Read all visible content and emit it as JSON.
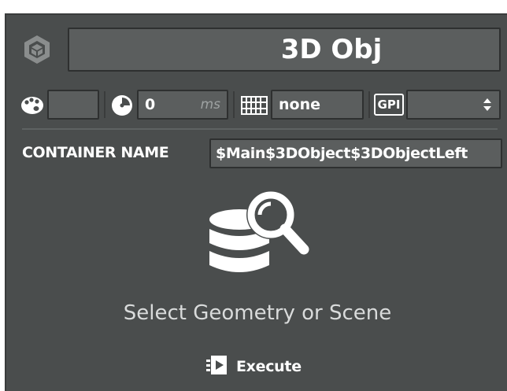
{
  "header": {
    "title": "3D Obj",
    "app_icon": "hexagon-box-icon"
  },
  "toolbar": {
    "color_icon": "palette-icon",
    "color_value": "",
    "timer_icon": "clock-icon",
    "duration_value": "0",
    "duration_unit": "ms",
    "keyframe_icon": "film-strip-icon",
    "keyframe_value": "none",
    "gpi_icon": "gpi-icon",
    "gpi_label": "GPI",
    "gpi_value": "",
    "gpi_stepper_icon": "up-down-arrows-icon"
  },
  "container": {
    "label": "CONTAINER NAME",
    "value": "$Main$3DObject$3DObjectLeft"
  },
  "body": {
    "icon": "database-search-icon",
    "status_text": "Select Geometry or Scene"
  },
  "footer": {
    "execute_icon": "execute-play-icon",
    "execute_label": "Execute"
  },
  "colors": {
    "panel_bg": "#4a4d4d",
    "field_bg": "#5b5e5e",
    "text": "#ffffff"
  }
}
